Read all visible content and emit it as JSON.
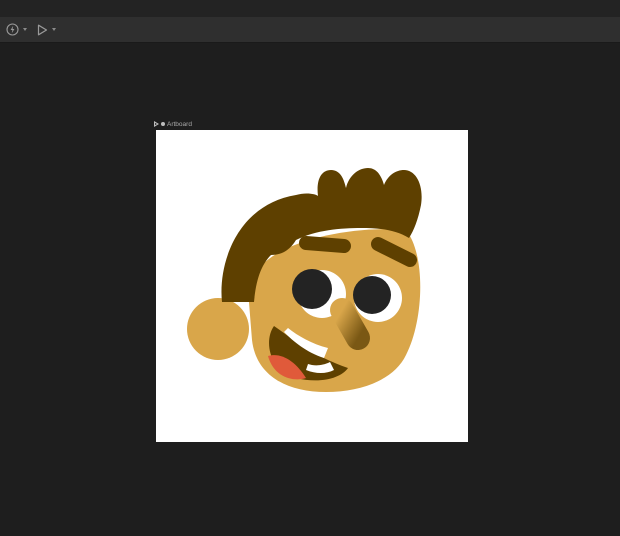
{
  "toolbar": {
    "actions": [
      {
        "name": "lightning-menu",
        "icon": "lightning-circle-icon"
      },
      {
        "name": "play-menu",
        "icon": "play-icon"
      }
    ]
  },
  "canvas": {
    "artboard": {
      "label": "Artboard",
      "background": "#ffffff"
    }
  },
  "colors": {
    "app_background": "#1e1e1e",
    "toolbar": "#2f2f2f",
    "hair": "#5e4000",
    "skin": "#d9a64a",
    "eye_white": "#ffffff",
    "pupil": "#232323",
    "mouth": "#5e4000",
    "tongue": "#e05a3a"
  }
}
